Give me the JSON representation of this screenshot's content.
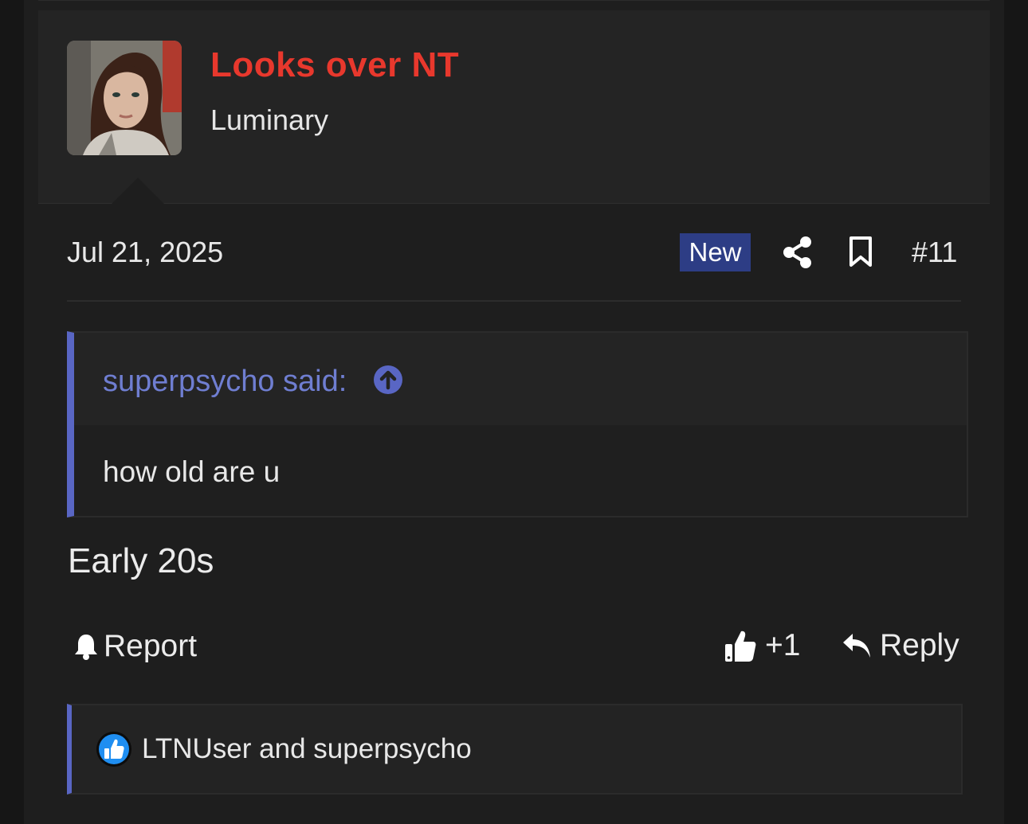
{
  "author": {
    "username": "Looks over NT",
    "title": "Luminary",
    "username_color": "#e8382d"
  },
  "post": {
    "date": "Jul 21, 2025",
    "badge": "New",
    "number": "#11",
    "text": "Early 20s"
  },
  "quote": {
    "author_label": "superpsycho said:",
    "body": "how old are u",
    "accent_color": "#5966c4"
  },
  "actions": {
    "report": "Report",
    "react": "+1",
    "reply": "Reply"
  },
  "reactions": {
    "users": "LTNUser and superpsycho"
  },
  "icons": {
    "share": "share-icon",
    "bookmark": "bookmark-icon",
    "quote_jump": "arrow-up-circle-icon",
    "report": "bell-icon",
    "react": "thumbs-up-icon",
    "reply": "reply-arrow-icon",
    "reaction_summary": "like-reaction-icon"
  }
}
